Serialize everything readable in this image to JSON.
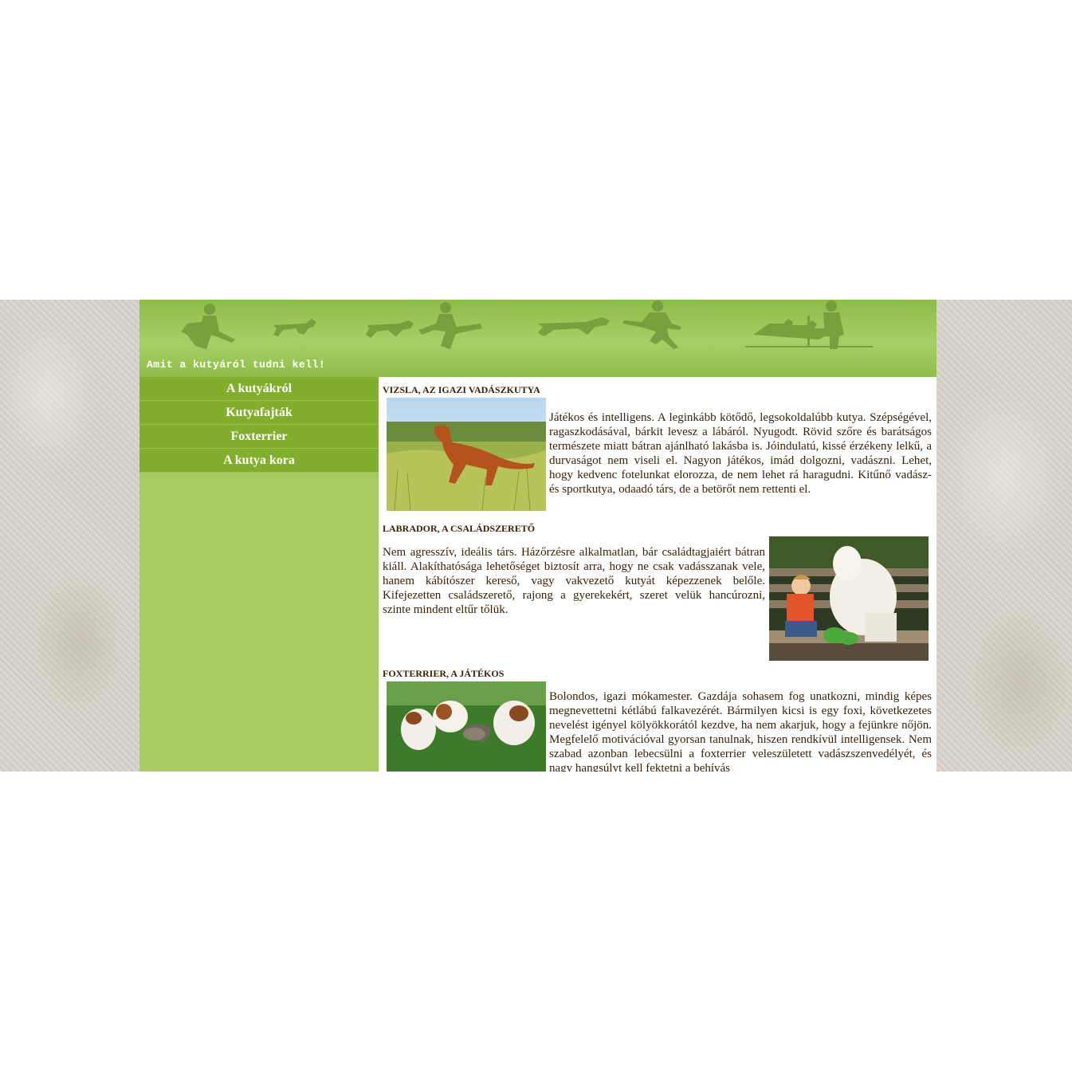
{
  "header": {
    "title": "Amit a kutyáról tudni kell!"
  },
  "nav": {
    "items": [
      {
        "label": "A kutyákról"
      },
      {
        "label": "Kutyafajták"
      },
      {
        "label": "Foxterrier"
      },
      {
        "label": "A kutya kora"
      }
    ]
  },
  "sections": [
    {
      "title": "VIZSLA, AZ IGAZI VADÁSZKUTYA",
      "text": "Játékos és intelligens. A leginkább kötődő, legsokoldalúbb kutya. Szépségével, ragaszkodásával, bárkit levesz a lábáról. Nyugodt. Rövid szőre és barátságos természete miatt bátran ajánlható lakásba is. Jóindulatú, kissé érzékeny lelkű, a durvaságot nem viseli el. Nagyon játékos, imád dolgozni, vadászni. Lehet, hogy kedvenc fotelunkat elorozza, de nem lehet rá haragudni. Kitűnő vadász- és sportkutya, odaadó társ, de a betörőt nem rettenti el.",
      "image": "vizsla-photo"
    },
    {
      "title": "LABRADOR, A CSALÁDSZERETŐ",
      "text": "Nem agresszív, ideális társ. Házőrzésre alkalmatlan, bár családtagjaiért bátran kiáll. Alakíthatósága lehetőséget biztosít arra, hogy ne csak vadásszanak vele, hanem kábítószer kereső, vagy vakvezető kutyát képezzenek belőle. Kifejezetten családszerető, rajong a gyerekekért, szeret velük hancúrozni, szinte mindent eltűr tőlük.",
      "image": "labrador-photo"
    },
    {
      "title": "FOXTERRIER, A JÁTÉKOS",
      "text": "Bolondos, igazi mókamester. Gazdája sohasem fog unatkozni, mindig képes megnevettetni kétlábú falkavezérét. Bármilyen kicsi is egy foxi, következetes nevelést igényel kölyökkorától kezdve, ha nem akarjuk, hogy a fejünkre nőjön. Megfelelő motivációval gyorsan tanulnak, hiszen rendkívül intelligensek. Nem szabad azonban lebecsülni a foxterrier veleszületett vadászszenvedélyét, és nagy hangsúlyt kell fektetni a behívás",
      "image": "foxterrier-photo"
    }
  ],
  "colors": {
    "header_green": "#a6d066",
    "nav_green": "#82ae2e",
    "sidebar_green": "#a8cc62",
    "text_brown": "#3a1f05"
  }
}
